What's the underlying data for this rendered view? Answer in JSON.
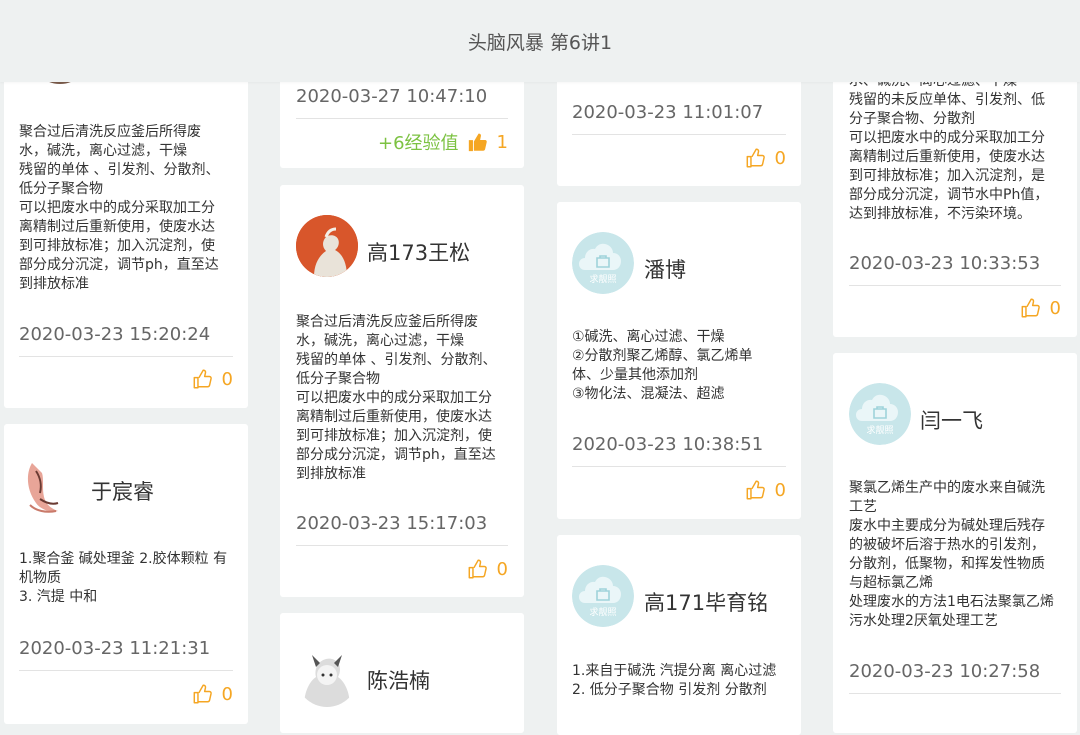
{
  "header": {
    "title": "头脑风暴 第6讲1"
  },
  "avatar_placeholder_text": "求靓照",
  "cards": [
    {
      "content": "聚合过后清洗反应釜后所得废\n水，碱洗，离心过滤，干燥\n残留的单体 、引发剂、分散剂、\n低分子聚合物\n可以把废水中的成分采取加工分\n离精制过后重新使用，使废水达\n到可排放标准；加入沉淀剂，使\n部分成分沉淀，调节ph，直至达\n到排放标准",
      "time": "2020-03-23 15:20:24",
      "likes": "0"
    },
    {
      "user": "于宸睿",
      "content": "1.聚合釜 碱处理釜  2.胶体颗粒 有\n机物质\n3. 汽提  中和",
      "time": "2020-03-23 11:21:31",
      "likes": "0"
    },
    {
      "time": "2020-03-27 10:47:10",
      "exp": "+6经验值",
      "likes": "1"
    },
    {
      "user": "高173王松",
      "content": "聚合过后清洗反应釜后所得废\n水，碱洗，离心过滤，干燥\n残留的单体 、引发剂、分散剂、\n低分子聚合物\n可以把废水中的成分采取加工分\n离精制过后重新使用，使废水达\n到可排放标准；加入沉淀剂，使\n部分成分沉淀，调节ph，直至达\n到排放标准",
      "time": "2020-03-23 15:17:03",
      "likes": "0"
    },
    {
      "user": "陈浩楠"
    },
    {
      "time": "2020-03-23 11:01:07",
      "likes": "0"
    },
    {
      "user": "潘博",
      "content": "①碱洗、离心过滤、干燥\n②分散剂聚乙烯醇、氯乙烯单\n体、少量其他添加剂\n③物化法、混凝法、超滤",
      "time": "2020-03-23 10:38:51",
      "likes": "0"
    },
    {
      "user": "高171毕育铭",
      "content": "1.来自于碱洗 汽提分离 离心过滤\n2. 低分子聚合物 引发剂 分散剂"
    },
    {
      "content": "水、碱洗、离心过滤、干燥\n残留的未反应单体、引发剂、低\n分子聚合物、分散剂\n可以把废水中的成分采取加工分\n离精制过后重新使用，使废水达\n到可排放标准；加入沉淀剂，是\n部分成分沉淀，调节水中Ph值，\n达到排放标准，不污染环境。",
      "time": "2020-03-23 10:33:53",
      "likes": "0"
    },
    {
      "user": "闫一飞",
      "content": "聚氯乙烯生产中的废水来自碱洗\n工艺\n废水中主要成分为碱处理后残存\n的被破坏后溶于热水的引发剂，\n分散剂，低聚物，和挥发性物质\n与超标氯乙烯\n处理废水的方法1电石法聚氯乙烯\n污水处理2厌氧处理工艺",
      "time": "2020-03-23 10:27:58"
    }
  ],
  "colors": {
    "background": "#eef1f1",
    "like": "#f5a623",
    "exp": "#7cc242",
    "placeholder_avatar": "#c8e6ea"
  }
}
